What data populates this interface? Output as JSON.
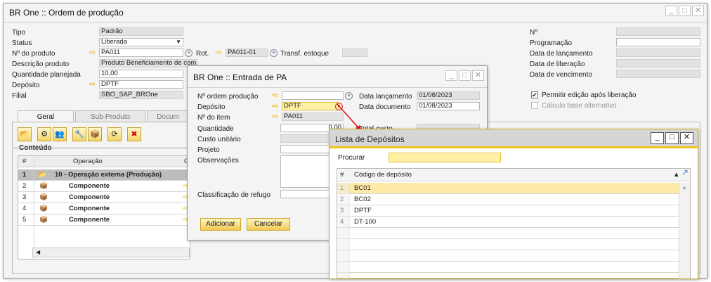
{
  "main": {
    "title": "BR One :: Ordem de produção",
    "tipo_label": "Tipo",
    "tipo_value": "Padrão",
    "status_label": "Status",
    "status_value": "Liberada",
    "produto_label": "Nº do produto",
    "produto_value": "PA011",
    "rot_label": "Rot.",
    "rot_value": "PA011-01",
    "transf_label": "Transf. estoque",
    "descricao_label": "Descrição produto",
    "descricao_value": "Produto Beneficiamento de compra",
    "qtd_label": "Quantidade planejada",
    "qtd_value": "10,00",
    "deposito_label": "Depósito",
    "deposito_value": "DPTF",
    "filial_label": "Filial",
    "filial_value": "SBO_SAP_BROne",
    "n_label": "Nº",
    "programacao_label": "Programação",
    "lancamento_label": "Data de lançamento",
    "liberacao_label": "Data de liberação",
    "vencimento_label": "Data de vencimento",
    "permitir_label": "Permitir edição após liberação",
    "calculo_label": "Cálculo base alternativo",
    "tabs": [
      "Geral",
      "Sub-Produto",
      "Docum"
    ],
    "conteudo_label": "Conteúdo",
    "grid_headers": {
      "num": "#",
      "operacao": "Operação",
      "c": "C"
    },
    "rows": [
      {
        "n": "1",
        "text": "10 - Operação externa (Produção)"
      },
      {
        "n": "2",
        "text": "Componente"
      },
      {
        "n": "3",
        "text": "Componente"
      },
      {
        "n": "4",
        "text": "Componente"
      },
      {
        "n": "5",
        "text": "Componente"
      }
    ]
  },
  "entrada": {
    "title": "BR One :: Entrada de PA",
    "ordem_label": "Nº ordem produção",
    "deposito_label": "Depósito",
    "deposito_value": "DPTF",
    "item_label": "Nº do item",
    "item_value": "PA011",
    "quantidade_label": "Quantidade",
    "quantidade_value": "0,00",
    "custo_label": "Custo unitário",
    "projeto_label": "Projeto",
    "obs_label": "Observações",
    "refugo_label": "Classificação de refugo",
    "lancamento_label": "Data lançamento",
    "lancamento_value": "01/08/2023",
    "documento_label": "Data documento",
    "documento_value": "01/08/2023",
    "total_partial": "Total custo",
    "add_label": "Adicionar",
    "cancel_label": "Cancelar"
  },
  "lista": {
    "title": "Lista de Depósitos",
    "procurar_label": "Procurar",
    "header_num": "#",
    "header_codigo": "Código de depósito",
    "items": [
      {
        "n": "1",
        "code": "BC01"
      },
      {
        "n": "2",
        "code": "BC02"
      },
      {
        "n": "3",
        "code": "DPTF"
      },
      {
        "n": "4",
        "code": "DT-100"
      }
    ]
  },
  "colors": {
    "accent": "#f0c419",
    "selected_row": "#ffe9a8",
    "title_active": "#d6d6d6"
  }
}
